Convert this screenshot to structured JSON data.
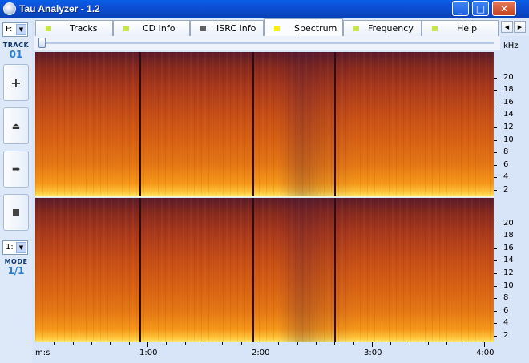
{
  "window": {
    "title": "Tau Analyzer - 1.2"
  },
  "left_panel": {
    "drive_value": "F:",
    "track_label": "TRACK",
    "track_number": "01",
    "buttons": [
      "add",
      "eject",
      "next",
      "stop"
    ],
    "mode_select_value": "1:",
    "mode_label": "MODE",
    "mode_value": "1/1"
  },
  "tabs": [
    {
      "label": "Tracks",
      "active": false,
      "indicator_color": "#c8e840"
    },
    {
      "label": "CD Info",
      "active": false,
      "indicator_color": "#c8e840"
    },
    {
      "label": "ISRC Info",
      "active": false,
      "indicator_color": "#606060"
    },
    {
      "label": "Spectrum",
      "active": true,
      "indicator_color": "#ffee00"
    },
    {
      "label": "Frequency",
      "active": false,
      "indicator_color": "#c8e840"
    },
    {
      "label": "Help",
      "active": false,
      "indicator_color": "#c8e840"
    }
  ],
  "spectrum": {
    "y_unit": "kHz",
    "y_ticks": [
      "20",
      "18",
      "16",
      "14",
      "12",
      "10",
      "8",
      "6",
      "4",
      "2"
    ],
    "x_label": "m:s",
    "x_ticks": [
      "1:00",
      "2:00",
      "3:00",
      "4:00"
    ],
    "track_marks_seconds": [
      56,
      116,
      160
    ]
  },
  "colors": {
    "titlebar": "#0c4fd6",
    "accent": "#2a7fd0"
  }
}
